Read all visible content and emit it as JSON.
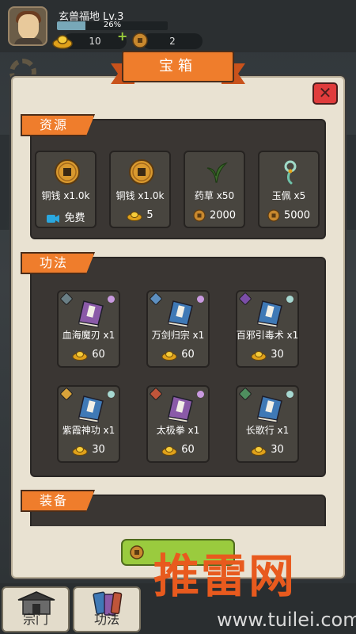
{
  "header": {
    "location_name": "玄兽福地",
    "level": "Lv.3",
    "xp_percent_text": "26%",
    "xp_fraction": 0.26,
    "gold_ingot_count": "10",
    "copper_coin_count": "2",
    "plus_symbol": "+"
  },
  "modal": {
    "title": "宝箱",
    "close_symbol": "✕"
  },
  "sections": {
    "resources": {
      "label": "资源",
      "items": [
        {
          "name": "铜钱 x1.0k",
          "price": "免费",
          "currency": "video-icon",
          "icon": "copper-coin-icon"
        },
        {
          "name": "铜钱 x1.0k",
          "price": "5",
          "currency": "gold-ingot-icon",
          "icon": "copper-coin-icon"
        },
        {
          "name": "药草 x50",
          "price": "2000",
          "currency": "copper-coin-icon",
          "icon": "herb-icon"
        },
        {
          "name": "玉佩 x5",
          "price": "5000",
          "currency": "copper-coin-icon",
          "icon": "jade-pendant-icon"
        }
      ]
    },
    "skills": {
      "label": "功法",
      "items": [
        {
          "name": "血海魔刃 x1",
          "price": "60",
          "book_color": "#8a5aa8",
          "dot_color": "#c99ae0",
          "badge_color": "#6a7f86"
        },
        {
          "name": "万剑归宗 x1",
          "price": "60",
          "book_color": "#3f79b6",
          "dot_color": "#c99ae0",
          "badge_color": "#5d8fc0"
        },
        {
          "name": "百邪引毒术 x1",
          "price": "30",
          "book_color": "#3f79b6",
          "dot_color": "#a7d9d2",
          "badge_color": "#7b4ea8"
        },
        {
          "name": "紫霞神功 x1",
          "price": "30",
          "book_color": "#3f79b6",
          "dot_color": "#a7d9d2",
          "badge_color": "#d9a33a"
        },
        {
          "name": "太极拳 x1",
          "price": "60",
          "book_color": "#8a5aa8",
          "dot_color": "#c99ae0",
          "badge_color": "#c0553a"
        },
        {
          "name": "长歌行 x1",
          "price": "30",
          "book_color": "#3f79b6",
          "dot_color": "#a7d9d2",
          "badge_color": "#4f8f5f"
        }
      ]
    },
    "equipment": {
      "label": "装备"
    }
  },
  "nav": {
    "tabs": [
      {
        "label": "宗门",
        "icon": "sect-gate-icon"
      },
      {
        "label": "功法",
        "icon": "skill-books-icon"
      }
    ]
  },
  "watermark": {
    "big_text": "推雷网",
    "url": "www.tuilei.com"
  },
  "colors": {
    "accent_orange": "#ef7d2c",
    "close_red": "#e03c3c",
    "panel_dark": "#3a3633",
    "card": "#48453f",
    "green_button": "#9acb3e"
  }
}
